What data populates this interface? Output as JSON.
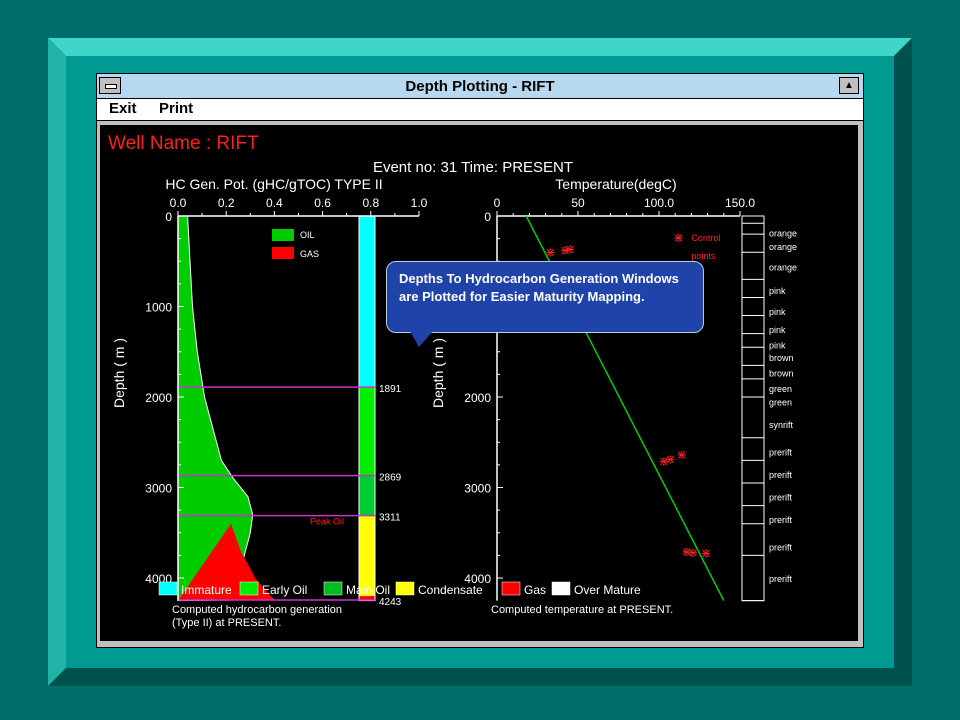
{
  "window": {
    "title": "Depth Plotting - RIFT",
    "maximize_glyph": "▲",
    "menu": [
      "Exit",
      "Print"
    ]
  },
  "header": {
    "well_name": "Well Name : RIFT",
    "event_line": "Event no: 31  Time: PRESENT"
  },
  "callout_text": "Depths To Hydrocarbon Generation Windows are Plotted for Easier Maturity Mapping.",
  "chart_data": [
    {
      "type": "area",
      "title": "HC Gen. Pot. (gHC/gTOC) TYPE II",
      "ylabel": "Depth ( m )",
      "xlim": [
        0,
        1.0
      ],
      "ylim": [
        0,
        4250
      ],
      "x_ticks": [
        "0.0",
        "0.2",
        "0.4",
        "0.6",
        "0.8",
        "1.0"
      ],
      "y_ticks": [
        "0",
        "1000",
        "2000",
        "3000",
        "4000"
      ],
      "legend": [
        "OIL",
        "GAS"
      ],
      "series": [
        {
          "name": "OIL",
          "color": "#00cc00",
          "depth": [
            0,
            500,
            1000,
            1500,
            2000,
            2400,
            2700,
            2900,
            3100,
            3300,
            3500,
            3700,
            3900,
            4100,
            4243
          ],
          "x": [
            0.04,
            0.05,
            0.06,
            0.08,
            0.11,
            0.15,
            0.18,
            0.23,
            0.29,
            0.31,
            0.3,
            0.28,
            0.26,
            0.24,
            0.23
          ]
        },
        {
          "name": "GAS",
          "color": "#ff0000",
          "depth": [
            3400,
            3700,
            4000,
            4243
          ],
          "x": [
            0.22,
            0.26,
            0.32,
            0.4
          ]
        }
      ],
      "maturity_column": [
        {
          "from": 0,
          "to": 1891,
          "color": "#00ffff"
        },
        {
          "from": 1891,
          "to": 2869,
          "color": "#00ee00"
        },
        {
          "from": 2869,
          "to": 3311,
          "color": "#00cc33"
        },
        {
          "from": 3311,
          "to": 4243,
          "color": "#ffff00"
        },
        {
          "from": 4200,
          "to": 4243,
          "color": "#ff0000"
        }
      ],
      "window_depths": [
        {
          "depth": 1891,
          "label": "1891"
        },
        {
          "depth": 2869,
          "label": "2869"
        },
        {
          "depth": 3311,
          "label": "3311"
        },
        {
          "depth": 4243,
          "label": "4243"
        }
      ],
      "annotation": "Peak Oil",
      "caption": [
        "Computed hydrocarbon generation",
        "(Type II) at PRESENT."
      ]
    },
    {
      "type": "line",
      "title": "Temperature(degC)",
      "ylabel": "Depth ( m )",
      "xlim": [
        0,
        150
      ],
      "ylim": [
        0,
        4250
      ],
      "x_ticks": [
        "0",
        "50",
        "100.0",
        "150.0"
      ],
      "y_ticks": [
        "0",
        "1000",
        "2000",
        "3000",
        "4000"
      ],
      "series": [
        {
          "name": "",
          "color": "#00cc00",
          "depth": [
            0,
            4250
          ],
          "x": [
            18,
            140
          ]
        }
      ],
      "control_points_label": [
        "Control",
        "points"
      ],
      "control_points": [
        {
          "depth": 390,
          "x": 33
        },
        {
          "depth": 370,
          "x": 42
        },
        {
          "depth": 360,
          "x": 45
        },
        {
          "depth": 2700,
          "x": 103
        },
        {
          "depth": 2680,
          "x": 107
        },
        {
          "depth": 2630,
          "x": 114
        },
        {
          "depth": 3700,
          "x": 117
        },
        {
          "depth": 3710,
          "x": 121
        },
        {
          "depth": 3720,
          "x": 129
        }
      ],
      "lithology": [
        "orange",
        "orange",
        "orange",
        "pink",
        "pink",
        "pink",
        "pink",
        "brown",
        "brown",
        "green",
        "green",
        "synrift",
        "prerift",
        "prerift",
        "prerift",
        "prerift",
        "prerift",
        "prerift"
      ],
      "caption": [
        "Computed temperature at PRESENT."
      ]
    }
  ],
  "maturity_legend": [
    {
      "label": "Immature",
      "color": "#00ffff"
    },
    {
      "label": "Early Oil",
      "color": "#00ee00"
    },
    {
      "label": "Main Oil",
      "color": "#00bb22"
    },
    {
      "label": "Condensate",
      "color": "#ffff00"
    },
    {
      "label": "Gas",
      "color": "#ff0000"
    },
    {
      "label": "Over Mature",
      "color": "#ffffff"
    }
  ]
}
